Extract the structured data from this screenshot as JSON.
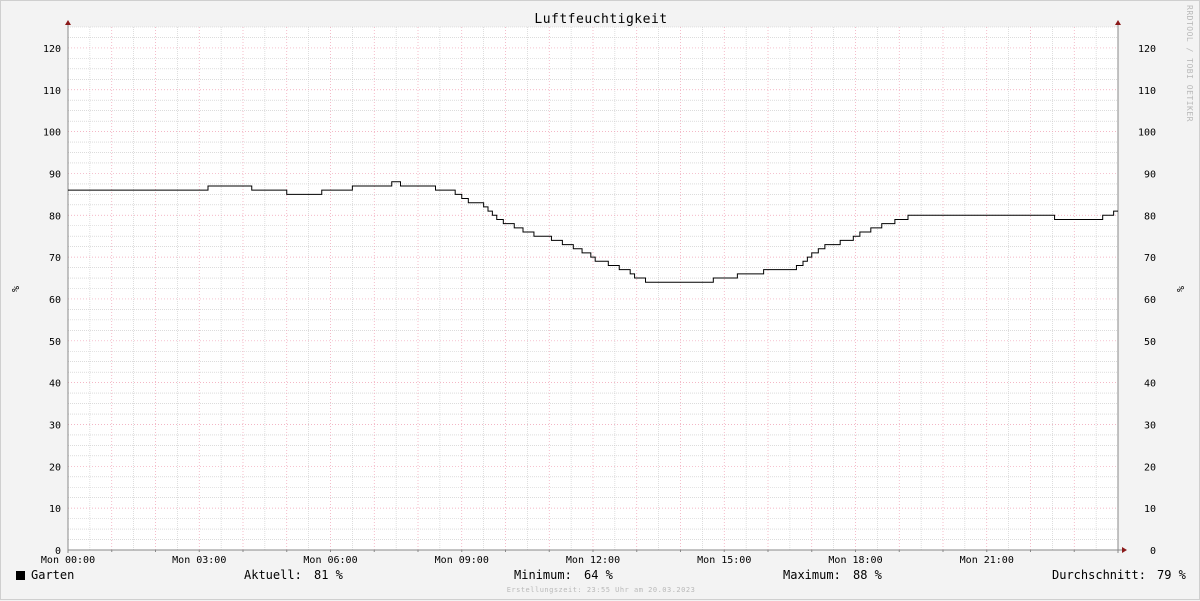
{
  "watermark": "RRDTOOL / TOBI OETIKER",
  "chart_data": {
    "type": "line",
    "title": "Luftfeuchtigkeit",
    "ylabel": "%",
    "ylabel_right": "%",
    "ylim": [
      0,
      125
    ],
    "yticks": [
      0,
      10,
      20,
      30,
      40,
      50,
      60,
      70,
      80,
      90,
      100,
      110,
      120
    ],
    "xlim_hours": [
      0,
      24
    ],
    "xticks": [
      {
        "hour": 0,
        "label": "Mon 00:00"
      },
      {
        "hour": 3,
        "label": "Mon 03:00"
      },
      {
        "hour": 6,
        "label": "Mon 06:00"
      },
      {
        "hour": 9,
        "label": "Mon 09:00"
      },
      {
        "hour": 12,
        "label": "Mon 12:00"
      },
      {
        "hour": 15,
        "label": "Mon 15:00"
      },
      {
        "hour": 18,
        "label": "Mon 18:00"
      },
      {
        "hour": 21,
        "label": "Mon 21:00"
      }
    ],
    "grid": true,
    "series": [
      {
        "name": "Garten",
        "color": "#000000",
        "x": [
          0.0,
          3.2,
          4.2,
          5.0,
          5.8,
          6.5,
          7.0,
          7.4,
          7.6,
          8.4,
          8.6,
          8.85,
          9.0,
          9.15,
          9.35,
          9.5,
          9.6,
          9.7,
          9.8,
          9.95,
          10.2,
          10.4,
          10.65,
          10.9,
          11.05,
          11.3,
          11.55,
          11.75,
          11.95,
          12.05,
          12.2,
          12.35,
          12.6,
          12.85,
          12.95,
          13.2,
          14.75,
          15.3,
          15.9,
          16.65,
          16.8,
          16.9,
          17.0,
          17.15,
          17.3,
          17.65,
          17.95,
          18.1,
          18.35,
          18.6,
          18.9,
          19.2,
          19.5,
          22.55,
          23.65,
          23.9,
          24.0
        ],
        "values": [
          86,
          87,
          86,
          85,
          86,
          87,
          87,
          88,
          87,
          86,
          86,
          85,
          84,
          83,
          83,
          82,
          81,
          80,
          79,
          78,
          77,
          76,
          75,
          75,
          74,
          73,
          72,
          71,
          70,
          69,
          69,
          68,
          67,
          66,
          65,
          64,
          65,
          66,
          67,
          68,
          69,
          70,
          71,
          72,
          73,
          74,
          75,
          76,
          77,
          78,
          79,
          80,
          80,
          79,
          80,
          81,
          81
        ]
      }
    ]
  },
  "legend": {
    "series_name": "Garten",
    "series_color": "#000000",
    "current_label": "Aktuell:",
    "current_value": "81 %",
    "min_label": "Minimum:",
    "min_value": "64 %",
    "max_label": "Maximum:",
    "max_value": "88 %",
    "avg_label": "Durchschnitt:",
    "avg_value": "79 %"
  },
  "footer": "Erstellungszeit: 23:55 Uhr am 20.03.2023",
  "colors": {
    "major_grid": "#f0a0b4",
    "minor_grid": "#c8c8c8",
    "axis": "#888888",
    "arrow": "#8b1a1a",
    "plot_bg": "#ffffff",
    "page_bg": "#f3f3f3"
  }
}
